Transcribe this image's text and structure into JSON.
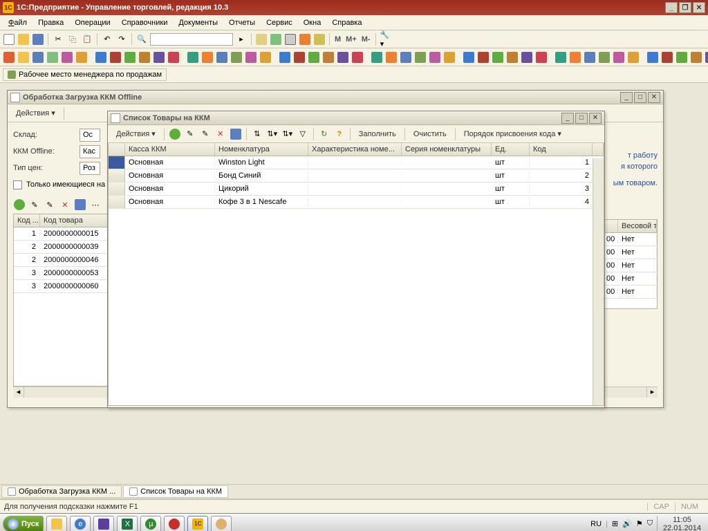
{
  "app": {
    "title": "1С:Предприятие - Управление торговлей, редакция 10.3"
  },
  "menu": [
    "Файл",
    "Правка",
    "Операции",
    "Справочники",
    "Документы",
    "Отчеты",
    "Сервис",
    "Окна",
    "Справка"
  ],
  "memory": [
    "M",
    "M+",
    "M-"
  ],
  "quickbar": {
    "manager_workplace": "Рабочее место менеджера по продажам"
  },
  "bg_window": {
    "title": "Обработка  Загрузка ККМ Offline",
    "actions_label": "Действия",
    "labels": {
      "sklad": "Склад:",
      "kkm": "ККМ Offline:",
      "price_type": "Тип цен:",
      "only_available": "Только имеющиеся на"
    },
    "values": {
      "sklad": "Ос",
      "kkm": "Кас",
      "price_type": "Роз"
    },
    "grid_headers": [
      "Код ...",
      "Код товара"
    ],
    "rows": [
      {
        "n": "1",
        "code": "2000000000015"
      },
      {
        "n": "2",
        "code": "2000000000039"
      },
      {
        "n": "2",
        "code": "2000000000046"
      },
      {
        "n": "3",
        "code": "2000000000053"
      },
      {
        "n": "3",
        "code": "2000000000060"
      }
    ],
    "right_headers": [
      "",
      "Весовой т"
    ],
    "right_rows": [
      {
        "v": "00",
        "w": "Нет"
      },
      {
        "v": "00",
        "w": "Нет"
      },
      {
        "v": "00",
        "w": "Нет"
      },
      {
        "v": "00",
        "w": "Нет"
      },
      {
        "v": "00",
        "w": "Нет"
      }
    ],
    "hint1": "т работу",
    "hint2": "я которого",
    "hint3": "ым товаром."
  },
  "fg_window": {
    "title": "Список Товары на ККМ",
    "actions_label": "Действия",
    "buttons": {
      "fill": "Заполнить",
      "clear": "Очистить",
      "code_order": "Порядок присвоения кода"
    },
    "headers": [
      "",
      "Касса ККМ",
      "Номенклатура",
      "Характеристика номе...",
      "Серия номенклатуры",
      "Ед.",
      "Код"
    ],
    "rows": [
      {
        "kassa": "Основная",
        "nom": "Winston Light",
        "har": "",
        "ser": "",
        "ed": "шт",
        "kod": "1"
      },
      {
        "kassa": "Основная",
        "nom": "Бонд Синий",
        "har": "",
        "ser": "",
        "ed": "шт",
        "kod": "2"
      },
      {
        "kassa": "Основная",
        "nom": "Цикорий",
        "har": "",
        "ser": "",
        "ed": "шт",
        "kod": "3"
      },
      {
        "kassa": "Основная",
        "nom": "Кофе 3 в 1 Nescafe",
        "har": "",
        "ser": "",
        "ed": "шт",
        "kod": "4"
      }
    ]
  },
  "wintabs": [
    {
      "label": "Обработка  Загрузка ККМ ..."
    },
    {
      "label": "Список Товары на ККМ"
    }
  ],
  "statusbar": {
    "hint": "Для получения подсказки нажмите F1",
    "cap": "CAP",
    "num": "NUM"
  },
  "taskbar": {
    "start": "Пуск",
    "lang": "RU",
    "time": "11:05",
    "date": "22.01.2014"
  }
}
